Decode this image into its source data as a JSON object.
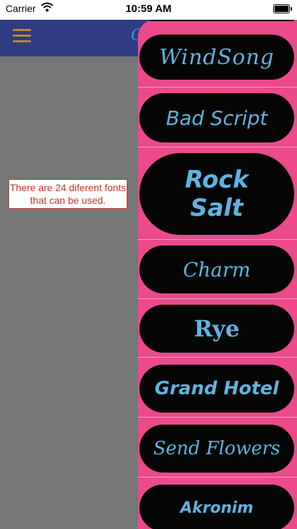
{
  "status_bar": {
    "carrier": "Carrier",
    "time": "10:59 AM"
  },
  "navbar": {
    "title_peek": "G"
  },
  "tooltip": {
    "text": "There are 24 diferent fonts that can be used."
  },
  "font_list": {
    "items": [
      {
        "label": ""
      },
      {
        "label": "WindSong"
      },
      {
        "label": "Bad Script"
      },
      {
        "label_line1": "Rock",
        "label_line2": "Salt"
      },
      {
        "label": "Charm"
      },
      {
        "label": "Rye"
      },
      {
        "label": "Grand Hotel"
      },
      {
        "label": "Send Flowers"
      },
      {
        "label": "Akronim"
      }
    ]
  },
  "colors": {
    "drawer_bg": "#ec4a8a",
    "pill_bg": "#050505",
    "font_text": "#5fb4e0",
    "navbar_bg": "#2f3b82",
    "overlay_bg": "#767676",
    "tooltip_border": "#d23b2a"
  }
}
